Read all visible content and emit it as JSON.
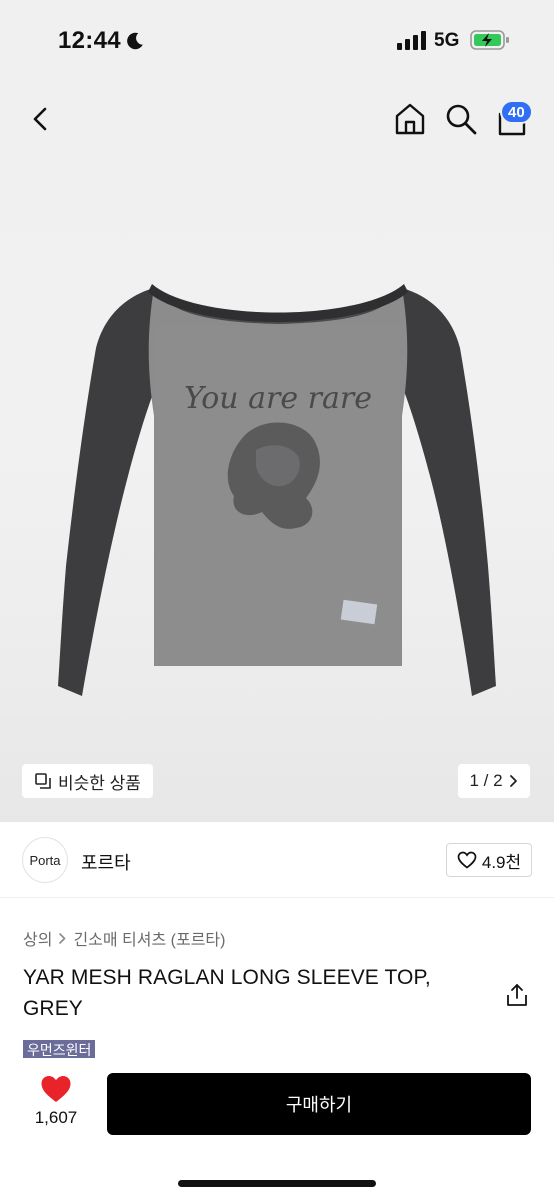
{
  "status_bar": {
    "time": "12:44",
    "network": "5G",
    "icons": [
      "moon-icon",
      "signal-icon",
      "battery-charging-icon"
    ]
  },
  "nav": {
    "icons": [
      "back-icon",
      "home-icon",
      "search-icon",
      "cart-icon"
    ],
    "cart_count": "40",
    "badge_color": "#2f6ef5"
  },
  "gallery": {
    "similar_label": "비슷한 상품",
    "similar_icon": "similar-products-icon",
    "pager": "1 / 2",
    "pager_icon": "chevron-right-icon",
    "print_text": "You are rare"
  },
  "brand": {
    "logo_text": "Porta",
    "name": "포르타",
    "likes": "4.9천",
    "like_icon": "heart-outline-icon"
  },
  "product": {
    "breadcrumb": [
      "상의",
      "긴소매 티셔츠 (포르타)"
    ],
    "title": "YAR MESH RAGLAN LONG SLEEVE TOP, GREY",
    "tag": "우먼즈윈터",
    "tag_color": "#6a6c9a",
    "share_icon": "share-icon"
  },
  "bottom_bar": {
    "wish_count": "1,607",
    "wish_icon": "heart-filled-icon",
    "heart_color": "#e8232a",
    "buy_label": "구매하기",
    "buy_color": "#000000"
  }
}
